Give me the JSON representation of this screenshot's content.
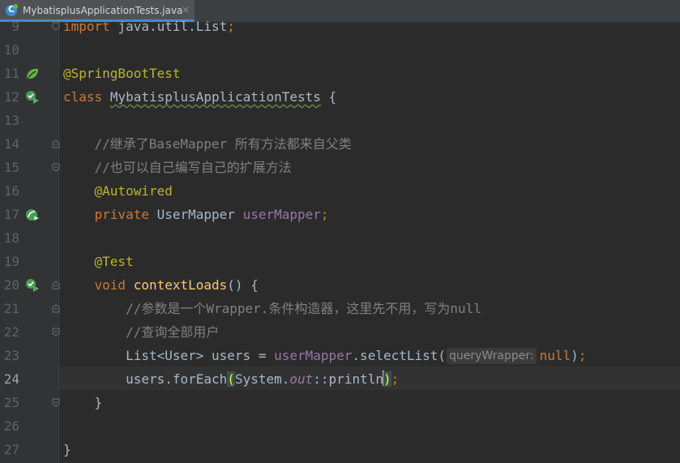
{
  "tab": {
    "filename": "MybatisplusApplicationTests.java",
    "close_glyph": "×",
    "accent": "#4a88c7"
  },
  "editor": {
    "theme": "darcula",
    "current_line": "24",
    "inlay_hint": "queryWrapper:",
    "lines": [
      {
        "n": "9",
        "text": "import java.util.List;"
      },
      {
        "n": "10",
        "text": ""
      },
      {
        "n": "11",
        "text": "@SpringBootTest"
      },
      {
        "n": "12",
        "text": "class MybatisplusApplicationTests {"
      },
      {
        "n": "13",
        "text": ""
      },
      {
        "n": "14",
        "text": "    //继承了BaseMapper 所有方法都来自父类"
      },
      {
        "n": "15",
        "text": "    //也可以自己编写自己的扩展方法"
      },
      {
        "n": "16",
        "text": "    @Autowired"
      },
      {
        "n": "17",
        "text": "    private UserMapper userMapper;"
      },
      {
        "n": "18",
        "text": ""
      },
      {
        "n": "19",
        "text": "    @Test"
      },
      {
        "n": "20",
        "text": "    void contextLoads() {"
      },
      {
        "n": "21",
        "text": "        //参数是一个Wrapper.条件构造器，这里先不用，写为null"
      },
      {
        "n": "22",
        "text": "        //查询全部用户"
      },
      {
        "n": "23",
        "text": "        List<User> users = userMapper.selectList(null);"
      },
      {
        "n": "24",
        "text": "        users.forEach(System.out::println);"
      },
      {
        "n": "25",
        "text": "    }"
      },
      {
        "n": "26",
        "text": ""
      },
      {
        "n": "27",
        "text": "}"
      }
    ],
    "tokens": {
      "l9": {
        "kw": "import",
        "rest": " java.util.List",
        "semi": ";"
      },
      "l11": {
        "ann": "@SpringBootTest"
      },
      "l12": {
        "kw": "class",
        "name": "MybatisplusApplicationTests",
        "rest": " {"
      },
      "l14": {
        "cmt": "//继承了BaseMapper 所有方法都来自父类"
      },
      "l15": {
        "cmt": "//也可以自己编写自己的扩展方法"
      },
      "l16": {
        "ann": "@Autowired"
      },
      "l17": {
        "kw": "private",
        "type": " UserMapper ",
        "fld": "userMapper",
        "semi": ";"
      },
      "l19": {
        "ann": "@Test"
      },
      "l20": {
        "kw": "void",
        "fn": "contextLoads",
        "rest": "() {"
      },
      "l21": {
        "cmt": "//参数是一个Wrapper.条件构造器，这里先不用，写为null"
      },
      "l22": {
        "cmt": "//查询全部用户"
      },
      "l23": {
        "pre": "List<User> users = ",
        "fld": "userMapper",
        "mid": ".selectList(",
        "kw": "null",
        "end": ")",
        "semi": ";"
      },
      "l24": {
        "pre": "users.forEach",
        "lp": "(",
        "cls": "System.",
        "fld": "out",
        "sep": "::",
        "m": "println",
        "rp": ")",
        "semi": ";"
      },
      "l25": {
        "rest": "}"
      },
      "l27": {
        "rest": "}"
      }
    },
    "gutter_icons": {
      "l11": "spring-bean-icon",
      "l12": "run-class-icon",
      "l17": "navigate-bean-icon",
      "l20": "run-test-icon"
    }
  }
}
